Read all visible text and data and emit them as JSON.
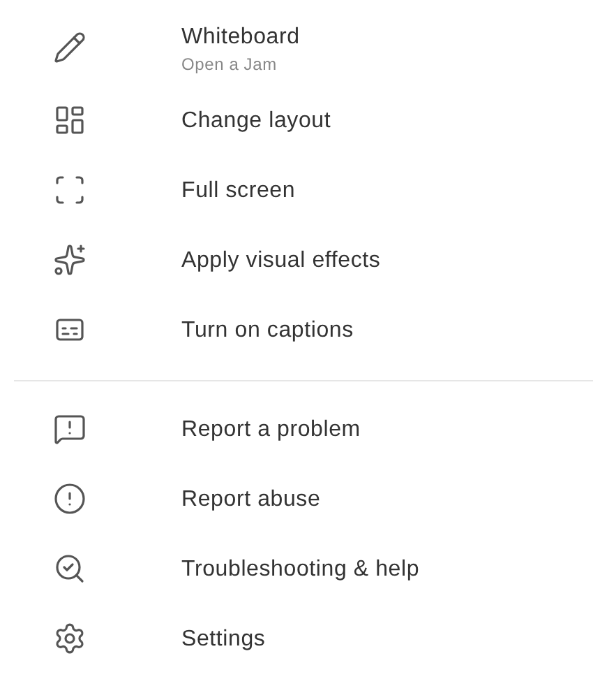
{
  "menu": {
    "sections": [
      {
        "items": [
          {
            "label": "Whiteboard",
            "subtitle": "Open a Jam"
          },
          {
            "label": "Change layout"
          },
          {
            "label": "Full screen"
          },
          {
            "label": "Apply visual effects"
          },
          {
            "label": "Turn on captions"
          }
        ]
      },
      {
        "items": [
          {
            "label": "Report a problem"
          },
          {
            "label": "Report abuse"
          },
          {
            "label": "Troubleshooting & help"
          },
          {
            "label": "Settings"
          }
        ]
      }
    ]
  }
}
